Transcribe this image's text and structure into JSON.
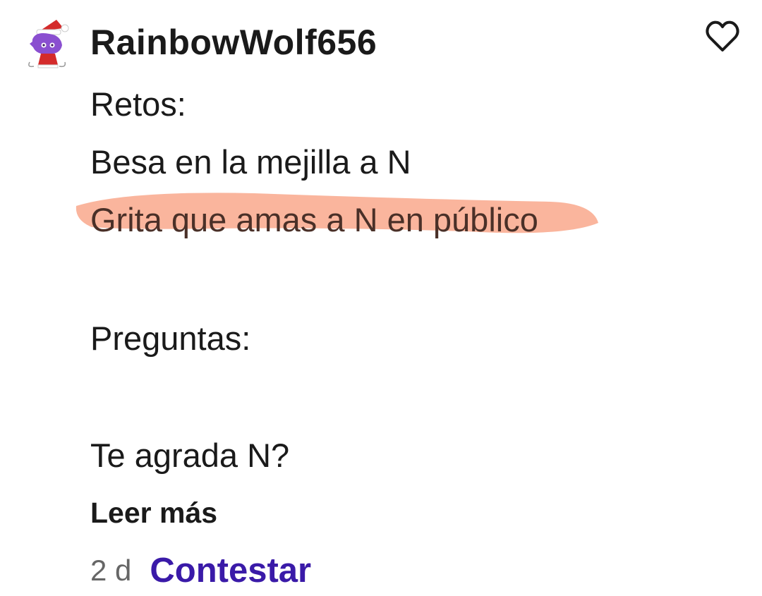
{
  "comment": {
    "author": "RainbowWolf656",
    "lines": [
      "Retos:",
      "Besa en la mejilla a N",
      "Grita que amas a N en público",
      "Preguntas:",
      "Te agrada N?"
    ],
    "highlighted_line_index": 2,
    "read_more_label": "Leer más",
    "time_ago": "2 d",
    "reply_label": "Contestar"
  },
  "icons": {
    "like": "heart-outline-icon",
    "avatar": "santa-hat-character-avatar"
  },
  "colors": {
    "text": "#1a1a1a",
    "muted": "#666666",
    "reply_link": "#3a1aa8",
    "highlight": "#f9a88c",
    "avatar_hair": "#8a4fd0",
    "santa_red": "#d42b2b"
  }
}
